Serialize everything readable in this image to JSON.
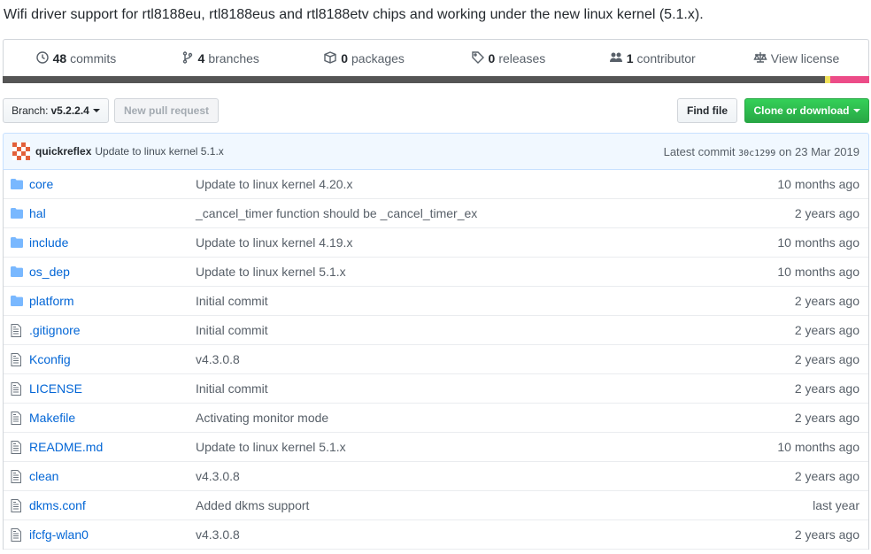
{
  "description": "Wifi driver support for rtl8188eu, rtl8188eus and rtl8188etv chips and working under the new linux kernel (5.1.x).",
  "summary": {
    "commits": {
      "count": "48",
      "label": "commits"
    },
    "branches": {
      "count": "4",
      "label": "branches"
    },
    "packages": {
      "count": "0",
      "label": "packages"
    },
    "releases": {
      "count": "0",
      "label": "releases"
    },
    "contributors": {
      "count": "1",
      "label": "contributor"
    },
    "license": {
      "label": "View license"
    }
  },
  "toolbar": {
    "branch_prefix": "Branch:",
    "branch_name": "v5.2.2.4",
    "new_pull_request": "New pull request",
    "find_file": "Find file",
    "clone_or_download": "Clone or download"
  },
  "latest_commit": {
    "author": "quickreflex",
    "message": "Update to linux kernel 5.1.x",
    "prefix": "Latest commit",
    "sha": "30c1299",
    "date_text": "on 23 Mar 2019"
  },
  "files": [
    {
      "type": "dir",
      "name": "core",
      "message": "Update to linux kernel 4.20.x",
      "age": "10 months ago"
    },
    {
      "type": "dir",
      "name": "hal",
      "message": "_cancel_timer function should be _cancel_timer_ex",
      "age": "2 years ago"
    },
    {
      "type": "dir",
      "name": "include",
      "message": "Update to linux kernel 4.19.x",
      "age": "10 months ago"
    },
    {
      "type": "dir",
      "name": "os_dep",
      "message": "Update to linux kernel 5.1.x",
      "age": "10 months ago"
    },
    {
      "type": "dir",
      "name": "platform",
      "message": "Initial commit",
      "age": "2 years ago"
    },
    {
      "type": "file",
      "name": ".gitignore",
      "message": "Initial commit",
      "age": "2 years ago"
    },
    {
      "type": "file",
      "name": "Kconfig",
      "message": "v4.3.0.8",
      "age": "2 years ago"
    },
    {
      "type": "file",
      "name": "LICENSE",
      "message": "Initial commit",
      "age": "2 years ago"
    },
    {
      "type": "file",
      "name": "Makefile",
      "message": "Activating monitor mode",
      "age": "2 years ago"
    },
    {
      "type": "file",
      "name": "README.md",
      "message": "Update to linux kernel 5.1.x",
      "age": "10 months ago"
    },
    {
      "type": "file",
      "name": "clean",
      "message": "v4.3.0.8",
      "age": "2 years ago"
    },
    {
      "type": "file",
      "name": "dkms.conf",
      "message": "Added dkms support",
      "age": "last year"
    },
    {
      "type": "file",
      "name": "ifcfg-wlan0",
      "message": "v4.3.0.8",
      "age": "2 years ago"
    }
  ],
  "colors": {
    "link": "#0366d6",
    "folder_icon": "#79b8ff",
    "clone_button": "#28a745",
    "language_bar_primary": "#555555",
    "language_bar_secondary": "#ec4c88"
  },
  "icons": {
    "dir": "folder-icon",
    "file": "file-text-icon"
  }
}
